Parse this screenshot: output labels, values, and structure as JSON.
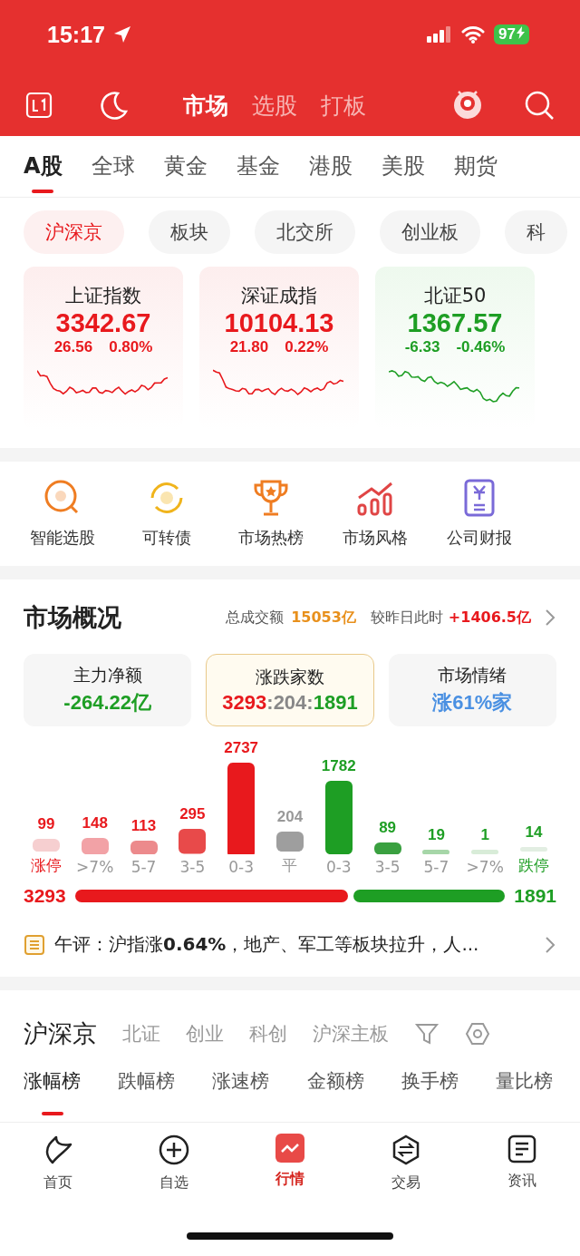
{
  "status_bar": {
    "time": "15:17",
    "battery": "97"
  },
  "top_nav": {
    "tabs": [
      {
        "label": "市场",
        "selected": true
      },
      {
        "label": "选股",
        "selected": false
      },
      {
        "label": "打板",
        "selected": false
      }
    ]
  },
  "market_tabs": [
    {
      "label": "A股",
      "selected": true
    },
    {
      "label": "全球",
      "selected": false
    },
    {
      "label": "黄金",
      "selected": false
    },
    {
      "label": "基金",
      "selected": false
    },
    {
      "label": "港股",
      "selected": false
    },
    {
      "label": "美股",
      "selected": false
    },
    {
      "label": "期货",
      "selected": false
    }
  ],
  "board_pills": [
    {
      "label": "沪深京",
      "selected": true
    },
    {
      "label": "板块",
      "selected": false
    },
    {
      "label": "北交所",
      "selected": false
    },
    {
      "label": "创业板",
      "selected": false
    },
    {
      "label": "科",
      "selected": false
    }
  ],
  "index_cards": [
    {
      "name": "上证指数",
      "price": "3342.67",
      "change": "26.56",
      "percent": "0.80%",
      "rising": true
    },
    {
      "name": "深证成指",
      "price": "10104.13",
      "change": "21.80",
      "percent": "0.22%",
      "rising": true
    },
    {
      "name": "北证50",
      "price": "1367.57",
      "change": "-6.33",
      "percent": "-0.46%",
      "rising": false
    }
  ],
  "shortcuts": [
    {
      "label": "智能选股",
      "kind": "pick"
    },
    {
      "label": "可转债",
      "kind": "bond"
    },
    {
      "label": "市场热榜",
      "kind": "trophy"
    },
    {
      "label": "市场风格",
      "kind": "chart"
    },
    {
      "label": "公司财报",
      "kind": "report"
    }
  ],
  "overview": {
    "title": "市场概况",
    "turnover_label": "总成交额",
    "turnover": "15053亿",
    "compare_label": "较昨日此时",
    "compare": "+1406.5亿",
    "stats": [
      {
        "label": "主力净额",
        "value": "-264.22亿",
        "kind": "down",
        "selected": false
      },
      {
        "label": "涨跌家数",
        "parts": [
          "3293",
          ":",
          "204",
          ":",
          "1891"
        ],
        "kind": "ratio",
        "selected": true
      },
      {
        "label": "市场情绪",
        "value": "涨61%家",
        "kind": "mood",
        "selected": false
      }
    ],
    "distribution": [
      {
        "category": "涨停",
        "count": "99",
        "color": "#f6cfd0",
        "kind": "limit_up"
      },
      {
        "category": ">7%",
        "count": "148",
        "color": "#f2a2a6",
        "kind": "range_up"
      },
      {
        "category": "5-7",
        "count": "113",
        "color": "#ec8a8c",
        "kind": "range_up"
      },
      {
        "category": "3-5",
        "count": "295",
        "color": "#e84a4a",
        "kind": "range_up"
      },
      {
        "category": "0-3",
        "count": "2737",
        "color": "#e8191d",
        "kind": "range_up"
      },
      {
        "category": "平",
        "count": "204",
        "color": "#9e9e9e",
        "kind": "flat"
      },
      {
        "category": "0-3",
        "count": "1782",
        "color": "#1e9e24",
        "kind": "range_down"
      },
      {
        "category": "3-5",
        "count": "89",
        "color": "#3aa040",
        "kind": "range_down"
      },
      {
        "category": "5-7",
        "count": "19",
        "color": "#a6d6a8",
        "kind": "range_down"
      },
      {
        "category": ">7%",
        "count": "1",
        "color": "#d8ecd8",
        "kind": "range_down"
      },
      {
        "category": "跌停",
        "count": "14",
        "color": "#e2eee2",
        "kind": "limit_down"
      }
    ],
    "up_total": "3293",
    "down_total": "1891",
    "comment": "午评：沪指涨**0.64%**，地产、军工等板块拉升，人..."
  },
  "ranking": {
    "title": "沪深京",
    "boards": [
      {
        "label": "北证"
      },
      {
        "label": "创业"
      },
      {
        "label": "科创"
      },
      {
        "label": "沪深主板"
      }
    ],
    "tabs": [
      {
        "label": "涨幅榜",
        "selected": true
      },
      {
        "label": "跌幅榜",
        "selected": false
      },
      {
        "label": "涨速榜",
        "selected": false
      },
      {
        "label": "金额榜",
        "selected": false
      },
      {
        "label": "换手榜",
        "selected": false
      },
      {
        "label": "量比榜",
        "selected": false
      }
    ]
  },
  "bottom_nav": [
    {
      "label": "首页",
      "kind": "home",
      "selected": false
    },
    {
      "label": "自选",
      "kind": "add",
      "selected": false
    },
    {
      "label": "行情",
      "kind": "market",
      "selected": true
    },
    {
      "label": "交易",
      "kind": "trade",
      "selected": false
    },
    {
      "label": "资讯",
      "kind": "news",
      "selected": false
    }
  ]
}
